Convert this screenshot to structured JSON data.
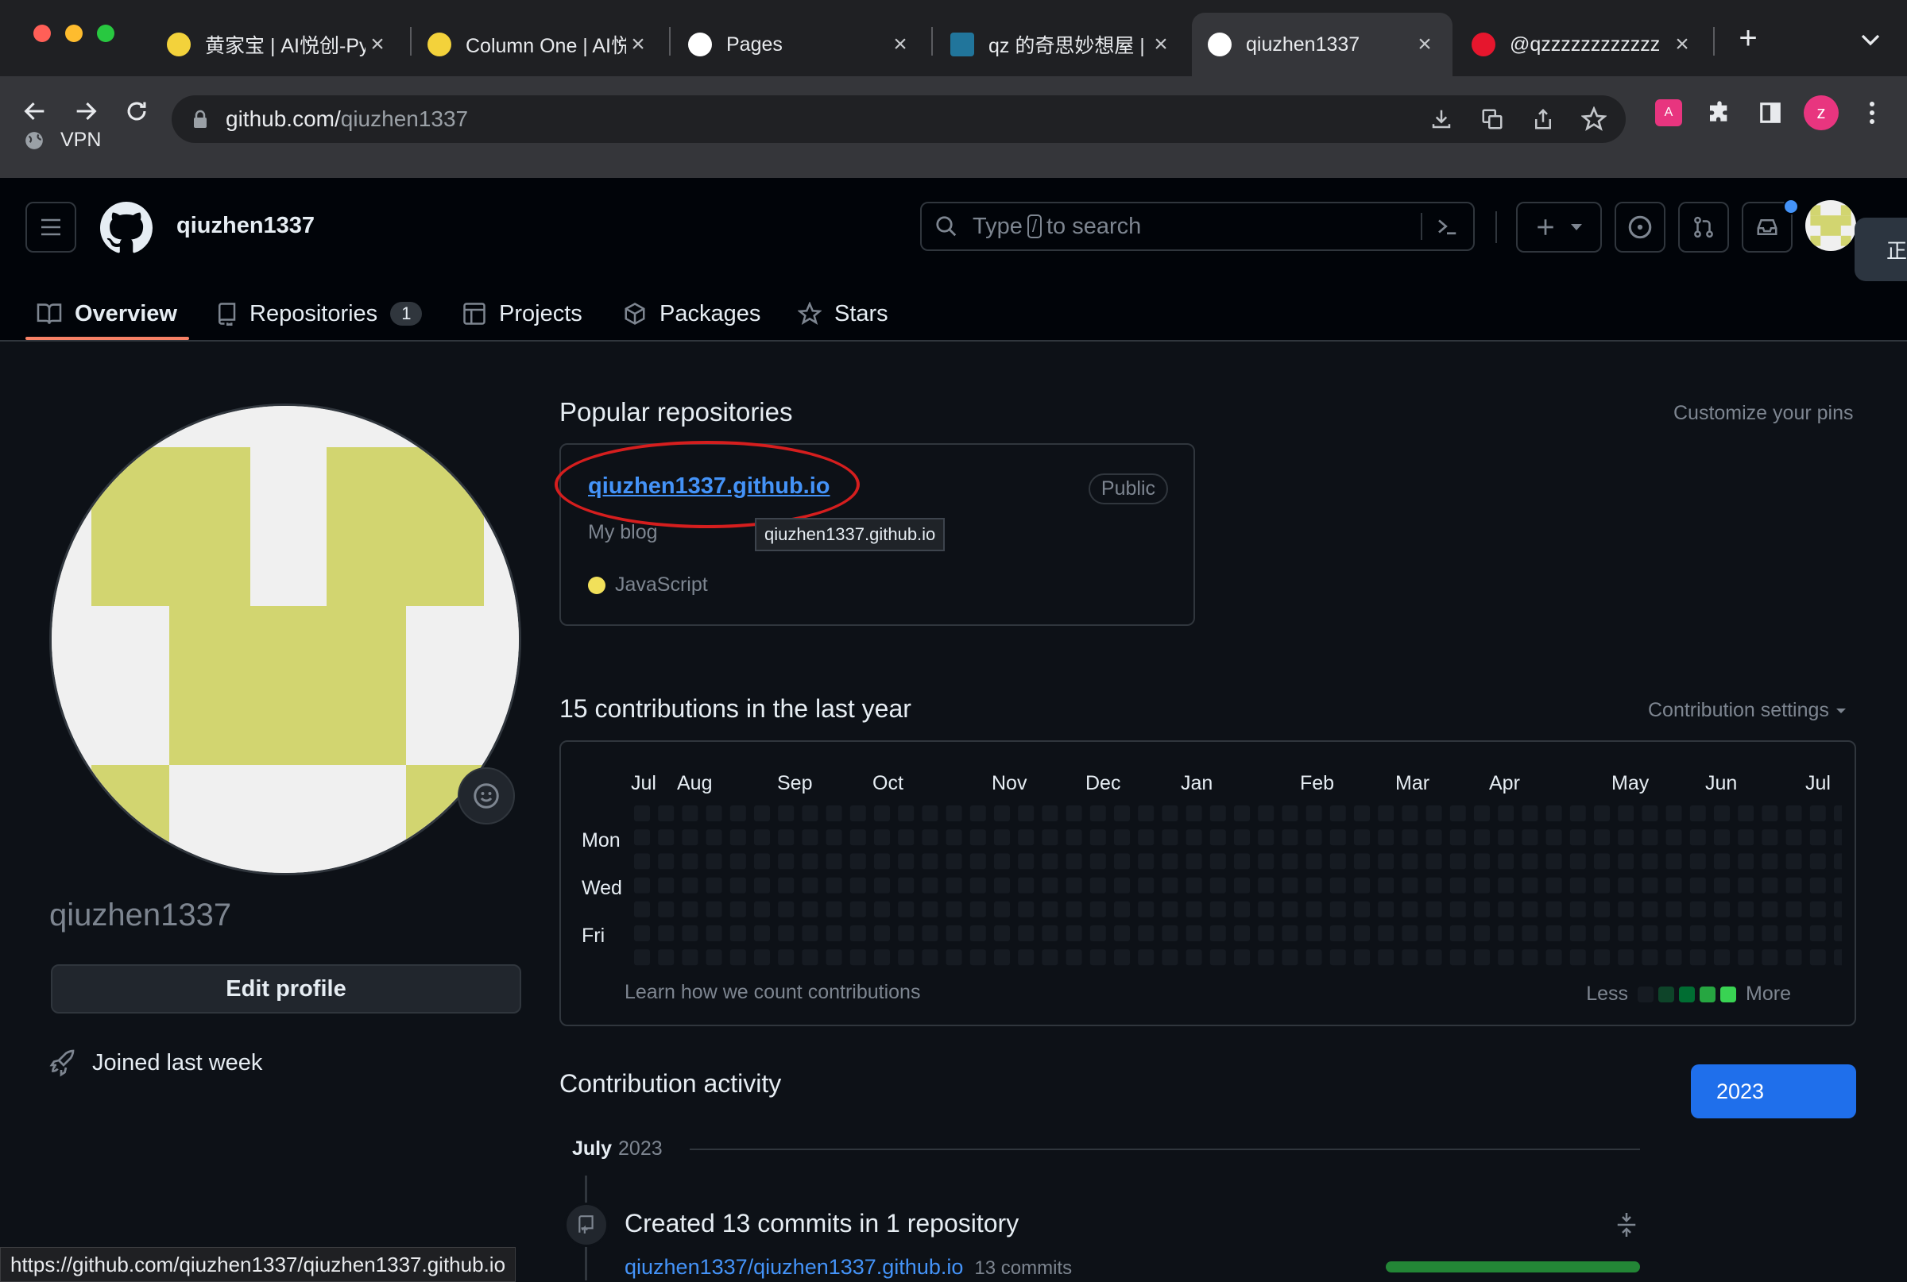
{
  "browser": {
    "tabs": [
      {
        "title": "黄家宝 | AI悦创-Py",
        "icon": "emoji-favicon-icon",
        "active": false
      },
      {
        "title": "Column One | AI悦",
        "icon": "emoji-favicon-icon",
        "active": false
      },
      {
        "title": "Pages",
        "icon": "github-icon",
        "active": false
      },
      {
        "title": "qz 的奇思妙想屋 |",
        "icon": "wordpress-favicon-icon",
        "active": false
      },
      {
        "title": "qiuzhen1337",
        "icon": "github-icon",
        "active": true
      },
      {
        "title": "@qzzzzzzzzzzzz",
        "icon": "weibo-icon",
        "active": false
      }
    ],
    "url_host": "github.com/",
    "url_path": "qiuzhen1337",
    "bookmark_vpn": "VPN",
    "profile_initial": "z",
    "status_url": "https://github.com/qiuzhen1337/qiuzhen1337.github.io",
    "colors": {
      "tabstrip": "#1f2023",
      "toolbar": "#35363a",
      "profile": "#e8357f"
    }
  },
  "header": {
    "username": "qiuzhen1337",
    "search_prefix": "Type",
    "search_key": "/",
    "search_suffix": "to search",
    "nav": [
      {
        "label": "Overview",
        "icon": "book-icon",
        "selected": true
      },
      {
        "label": "Repositories",
        "icon": "repo-icon",
        "count": "1"
      },
      {
        "label": "Projects",
        "icon": "table-icon"
      },
      {
        "label": "Packages",
        "icon": "package-icon"
      },
      {
        "label": "Stars",
        "icon": "star-icon"
      }
    ],
    "side_tab_char": "正"
  },
  "sidebar": {
    "name": "qiuzhen1337",
    "edit_profile": "Edit profile",
    "joined": "Joined last week",
    "avatar_color": "#d2d570"
  },
  "main": {
    "popular_title": "Popular repositories",
    "customize_pins": "Customize your pins",
    "repo": {
      "name": "qiuzhen1337.github.io",
      "visibility": "Public",
      "description": "My blog",
      "language": "JavaScript",
      "language_color": "#f1e05a",
      "tooltip": "qiuzhen1337.github.io"
    },
    "contrib_title": "15 contributions in the last year",
    "contrib_settings": "Contribution settings",
    "months": [
      "Jul",
      "Aug",
      "Sep",
      "Oct",
      "Nov",
      "Dec",
      "Jan",
      "Feb",
      "Mar",
      "Apr",
      "May",
      "Jun",
      "Jul"
    ],
    "days": [
      "Mon",
      "Wed",
      "Fri"
    ],
    "learn_link": "Learn how we count contributions",
    "legend_less": "Less",
    "legend_more": "More",
    "legend_colors": [
      "#161b22",
      "#0e4429",
      "#006d32",
      "#26a641",
      "#39d353"
    ],
    "activity_title": "Contribution activity",
    "year": "2023",
    "period_month": "July",
    "period_year": "2023",
    "activity_item": "Created 13 commits in 1 repository",
    "activity_repo": "qiuzhen1337/qiuzhen1337.github.io",
    "activity_commits": "13 commits"
  }
}
